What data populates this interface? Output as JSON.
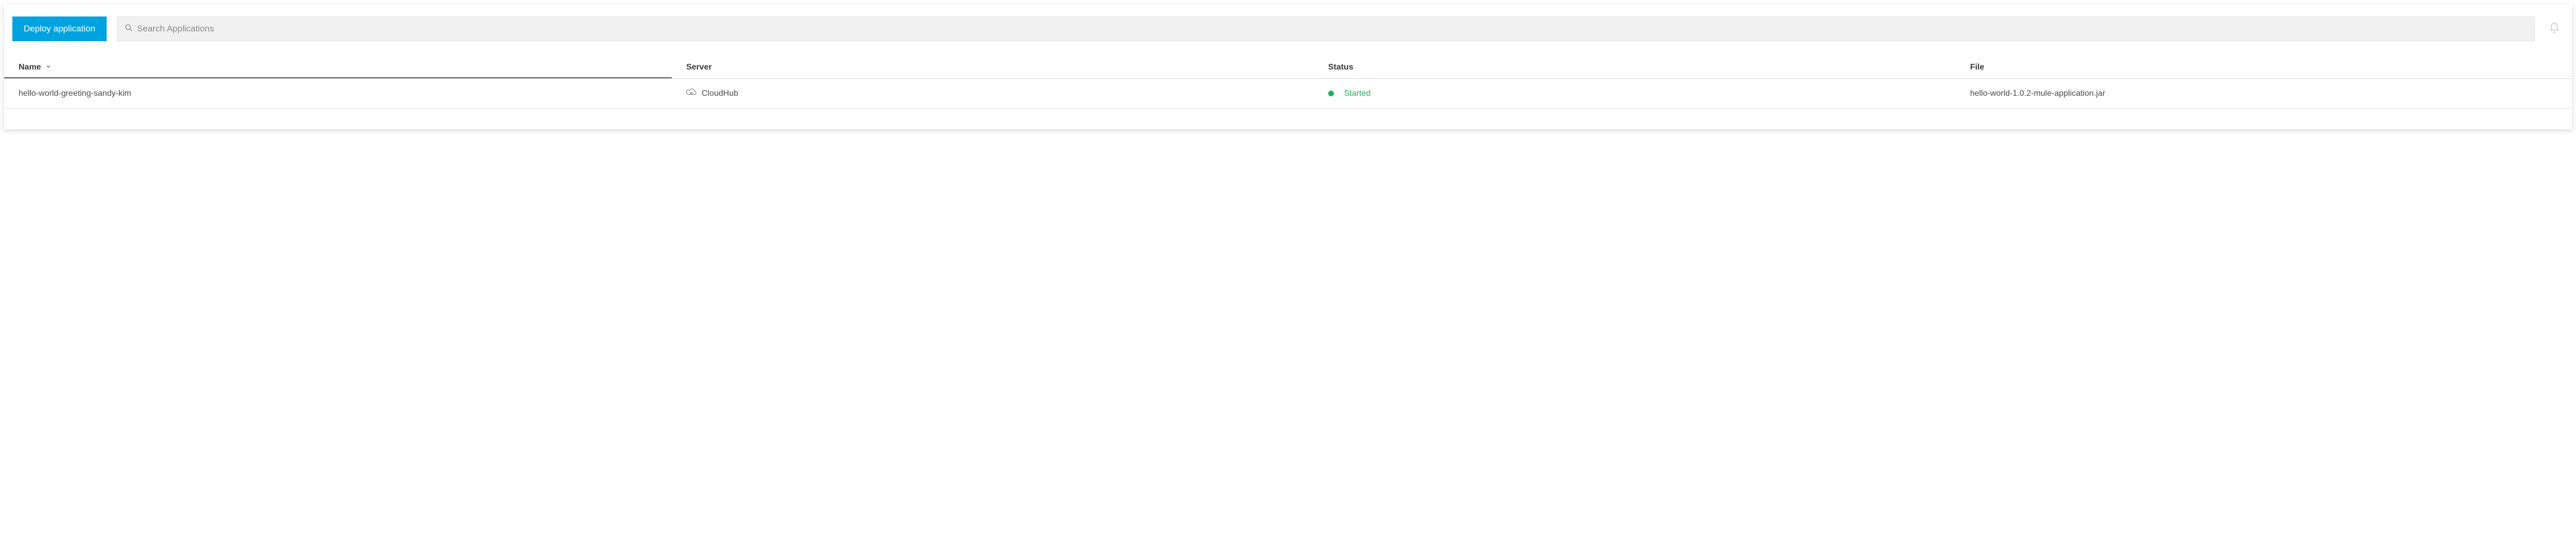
{
  "toolbar": {
    "deploy_label": "Deploy application",
    "search_placeholder": "Search Applications"
  },
  "columns": {
    "name": "Name",
    "server": "Server",
    "status": "Status",
    "file": "File"
  },
  "rows": [
    {
      "name": "hello-world-greeting-sandy-kim",
      "server": "CloudHub",
      "status": "Started",
      "status_color": "#17b35a",
      "file": "hello-world-1.0.2-mule-application.jar"
    }
  ]
}
